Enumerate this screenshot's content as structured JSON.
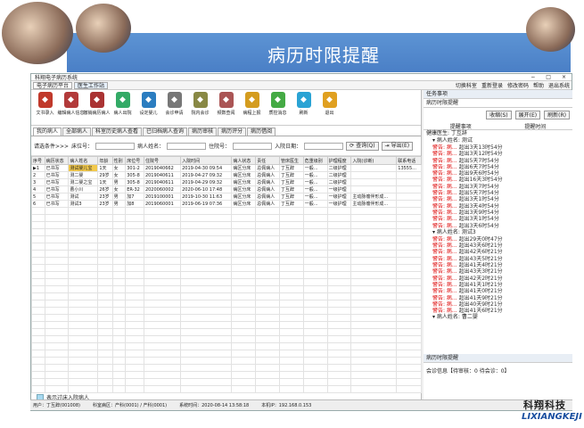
{
  "slide": {
    "title": "病历时限提醒"
  },
  "window": {
    "title": "科翔电子病历系统",
    "tabs": [
      "电子病历平台",
      "医生工作站"
    ],
    "top_links": [
      "切换科室",
      "重新登录",
      "修改密码",
      "帮助",
      "退出系统"
    ]
  },
  "toolbar": [
    {
      "label": "文书录入",
      "color": "#c0392b"
    },
    {
      "label": "编辑病人信息",
      "color": "#b23a3a"
    },
    {
      "label": "撤销病历病人",
      "color": "#a33"
    },
    {
      "label": "病人出院",
      "color": "#3a6"
    },
    {
      "label": "设定婴儿",
      "color": "#2b7dc0"
    },
    {
      "label": "会诊申请",
      "color": "#777"
    },
    {
      "label": "院内会诊",
      "color": "#884"
    },
    {
      "label": "频数查阅",
      "color": "#a55"
    },
    {
      "label": "病程上报",
      "color": "#d49c1f"
    },
    {
      "label": "质控消息",
      "color": "#4a4"
    },
    {
      "label": "刷新",
      "color": "#2aa3d4"
    },
    {
      "label": "退出",
      "color": "#e0a020"
    }
  ],
  "tabs": [
    "我的病人",
    "全部病人",
    "科室历史病人查看",
    "已归档病人查询",
    "病历审核",
    "病历评分",
    "病历借阅"
  ],
  "filter": {
    "label": "请选条件>>>",
    "fields": [
      "床位号：",
      "病人姓名：",
      "住院号：",
      "入院日期："
    ],
    "query": "查询(Q)",
    "export": "导出(E)"
  },
  "table": {
    "headers": [
      "序号",
      "病历状态",
      "病人姓名",
      "年龄",
      "性别",
      "床位号",
      "住院号",
      "入院时间",
      "病人状态",
      "责任",
      "管床医生",
      "危重级别",
      "护理程度",
      "入院(诊断)",
      "联系电话"
    ],
    "rows": [
      [
        "▶1",
        "已书写",
        "测试婴儿宝",
        "1天",
        "女",
        "301-2",
        "2019040662",
        "2019-04-30 09:54",
        "病区分床",
        "总佩病人",
        "丁互辞",
        "一般...",
        "二级护理",
        "",
        "13555..."
      ],
      [
        "2",
        "已书写",
        "测二婴",
        "29岁",
        "女",
        "305-8",
        "2019040611",
        "2019-04-27 09:32",
        "病区分床",
        "总佩病人",
        "丁互辞",
        "一般...",
        "二级护理",
        "",
        ""
      ],
      [
        "3",
        "已书写",
        "测二婴之宝",
        "1天",
        "男",
        "305-8",
        "2019040611",
        "2019-04-29 09:32",
        "病区分床",
        "总佩病人",
        "丁互辞",
        "一般...",
        "二级护理",
        "",
        ""
      ],
      [
        "4",
        "已书写",
        "曹小川",
        "26岁",
        "女",
        "ER-32",
        "2020060002",
        "2020-06-10 17:48",
        "病区分床",
        "总佩病人",
        "丁互辞",
        "一般...",
        "一级护理",
        "",
        ""
      ],
      [
        "5",
        "已书写",
        "测试",
        "23岁",
        "男",
        "加7",
        "2019100001",
        "2019-10-30 11:63",
        "病区分床",
        "总佩病人",
        "丁互辞",
        "一般...",
        "一级护理",
        "主动脉瘤伴形成...",
        ""
      ],
      [
        "6",
        "已书写",
        "测试3",
        "23岁",
        "男",
        "加8",
        "2019060001",
        "2019-06-19 07:36",
        "病区分床",
        "总佩病人",
        "丁互辞",
        "一般...",
        "一级护理",
        "主动脉瘤伴形成...",
        ""
      ]
    ]
  },
  "legend": "表示过床入院病人",
  "side": {
    "header": "任务事项",
    "sub": "病历时限提醒",
    "buttons": [
      "收缩(S)",
      "展开(E)",
      "刷新(R)"
    ],
    "cols": [
      "提醒事项",
      "提醒时间"
    ],
    "root": "健康医生: 丁互辞",
    "groups": [
      {
        "name": "病人姓名: 测试",
        "alerts": [
          [
            "警告: 病...",
            "超出3天13时54分"
          ],
          [
            "警告: 病...",
            "超出3天12时54分"
          ],
          [
            "警告: 病...",
            "超出5天7时54分"
          ],
          [
            "警告: 病...",
            "超出6天7时54分"
          ],
          [
            "警告: 病...",
            "超出9天6时54分"
          ],
          [
            "警告: 病...",
            "超出16天3时54分"
          ],
          [
            "警告: 病...",
            "超出3天7时54分"
          ],
          [
            "警告: 病...",
            "超出5天7时54分"
          ],
          [
            "警告: 病...",
            "超出3天1时54分"
          ],
          [
            "警告: 病...",
            "超出3天4时54分"
          ],
          [
            "警告: 病...",
            "超出3天9时54分"
          ],
          [
            "警告: 病...",
            "超出3天1时54分"
          ],
          [
            "警告: 病...",
            "超出3天6时54分"
          ]
        ]
      },
      {
        "name": "病人姓名: 测试3",
        "alerts": [
          [
            "警告: 病...",
            "超出29天0时47分"
          ],
          [
            "警告: 病...",
            "超出43天6时21分"
          ],
          [
            "警告: 病...",
            "超出42天6时21分"
          ],
          [
            "警告: 病...",
            "超出43天5时21分"
          ],
          [
            "警告: 病...",
            "超出41天4时21分"
          ],
          [
            "警告: 病...",
            "超出43天3时21分"
          ],
          [
            "警告: 病...",
            "超出42天2时21分"
          ],
          [
            "警告: 病...",
            "超出41天1时21分"
          ],
          [
            "警告: 病...",
            "超出41天0时21分"
          ],
          [
            "警告: 病...",
            "超出41天9时21分"
          ],
          [
            "警告: 病...",
            "超出40天9时21分"
          ],
          [
            "警告: 病...",
            "超出41天6时21分"
          ]
        ]
      },
      {
        "name": "病人姓名: 曹二婴",
        "alerts": []
      }
    ],
    "sub2": "病历时限提醒",
    "info": "会诊信息【待审核：0  待会诊：0】"
  },
  "status": [
    "用户：丁互辞(001008)",
    "科室病区：产科(0001) / 产科(0001)",
    "系统时间：2020-08-14 13:58:18",
    "本机IP：192.168.0.153"
  ],
  "brand": {
    "cn": "科翔科技",
    "en": "LIXIANGKEJI"
  }
}
